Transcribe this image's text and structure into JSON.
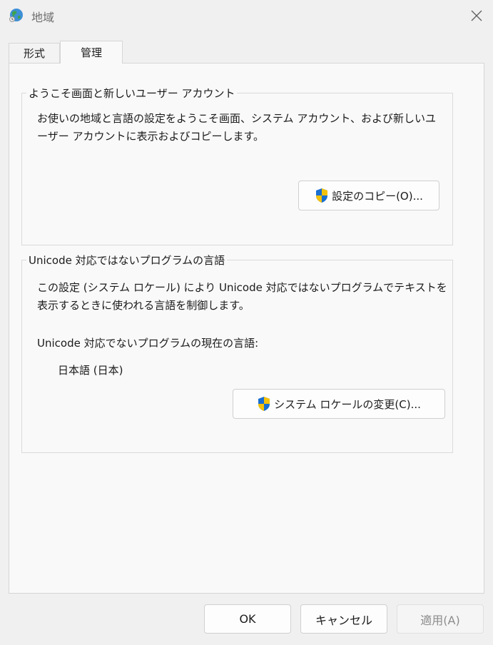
{
  "window": {
    "title": "地域"
  },
  "tabs": [
    {
      "label": "形式"
    },
    {
      "label": "管理"
    }
  ],
  "welcome_group": {
    "label": "ようこそ画面と新しいユーザー アカウント",
    "description_line1": "お使いの地域と言語の設定をようこそ画面、システム アカウント、および新しいユ",
    "description_line2": "ーザー アカウントに表示およびコピーします。",
    "copy_button": "設定のコピー(O)..."
  },
  "unicode_group": {
    "label": "Unicode 対応ではないプログラムの言語",
    "description_line1": "この設定 (システム ロケール) により Unicode 対応ではないプログラムでテキストを",
    "description_line2": "表示するときに使われる言語を制御します。",
    "current_label": "Unicode 対応でないプログラムの現在の言語:",
    "current_value": "日本語 (日本)",
    "change_button": "システム ロケールの変更(C)..."
  },
  "footer": {
    "ok": "OK",
    "cancel": "キャンセル",
    "apply": "適用(A)"
  },
  "colors": {
    "shield_blue": "#1a6fd1",
    "shield_yellow": "#f4c20d"
  },
  "icons": {
    "app": "globe-icon",
    "close": "close-icon",
    "shield": "uac-shield-icon"
  }
}
